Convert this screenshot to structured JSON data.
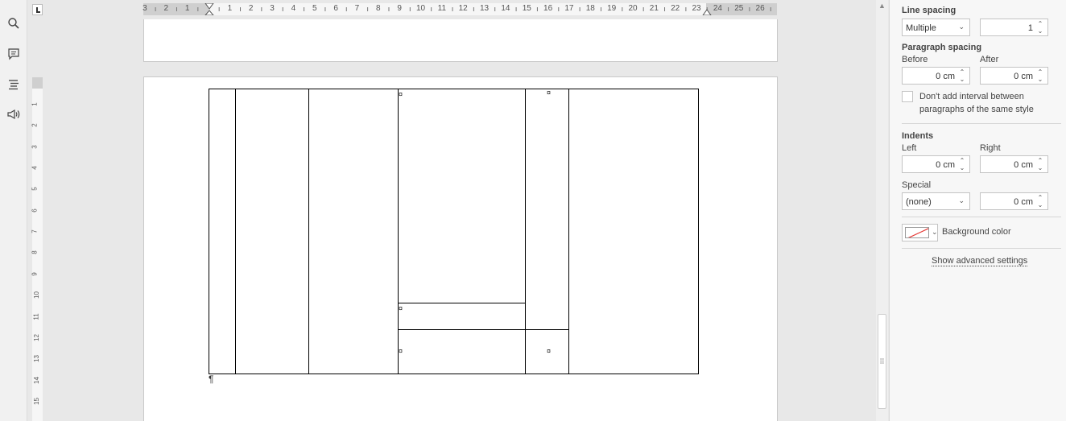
{
  "left_toolbar": {
    "icons": [
      "search-icon",
      "comment-icon",
      "navigation-icon",
      "speaker-icon"
    ]
  },
  "ruler": {
    "horizontal_labels": [
      "3",
      "2",
      "1",
      "1",
      "2",
      "3",
      "4",
      "5",
      "6",
      "7",
      "8",
      "9",
      "10",
      "11",
      "12",
      "13",
      "14",
      "15",
      "16",
      "17",
      "18",
      "19",
      "20",
      "21",
      "22",
      "23",
      "24",
      "25",
      "26"
    ],
    "vertical_labels": [
      "1",
      "2",
      "3",
      "4",
      "5",
      "6",
      "7",
      "8",
      "9",
      "10",
      "11",
      "12",
      "13",
      "14",
      "15"
    ]
  },
  "document": {
    "cell_markers": [
      "¤",
      "¤",
      "¤",
      "¤",
      "¤"
    ],
    "paragraph_mark": "¶"
  },
  "panel": {
    "line_spacing": {
      "title": "Line spacing",
      "mode": "Multiple",
      "value": "1"
    },
    "paragraph_spacing": {
      "title": "Paragraph spacing",
      "before_label": "Before",
      "before_value": "0 cm",
      "after_label": "After",
      "after_value": "0 cm"
    },
    "dont_add_interval": {
      "label_line1": "Don't add interval between",
      "label_line2": "paragraphs of the same style",
      "checked": false
    },
    "indents": {
      "title": "Indents",
      "left_label": "Left",
      "left_value": "0 cm",
      "right_label": "Right",
      "right_value": "0 cm",
      "special_label": "Special",
      "special_value": "(none)",
      "special_amount": "0 cm"
    },
    "background_color": {
      "label": "Background color",
      "value": "none"
    },
    "advanced_link": "Show advanced settings"
  }
}
